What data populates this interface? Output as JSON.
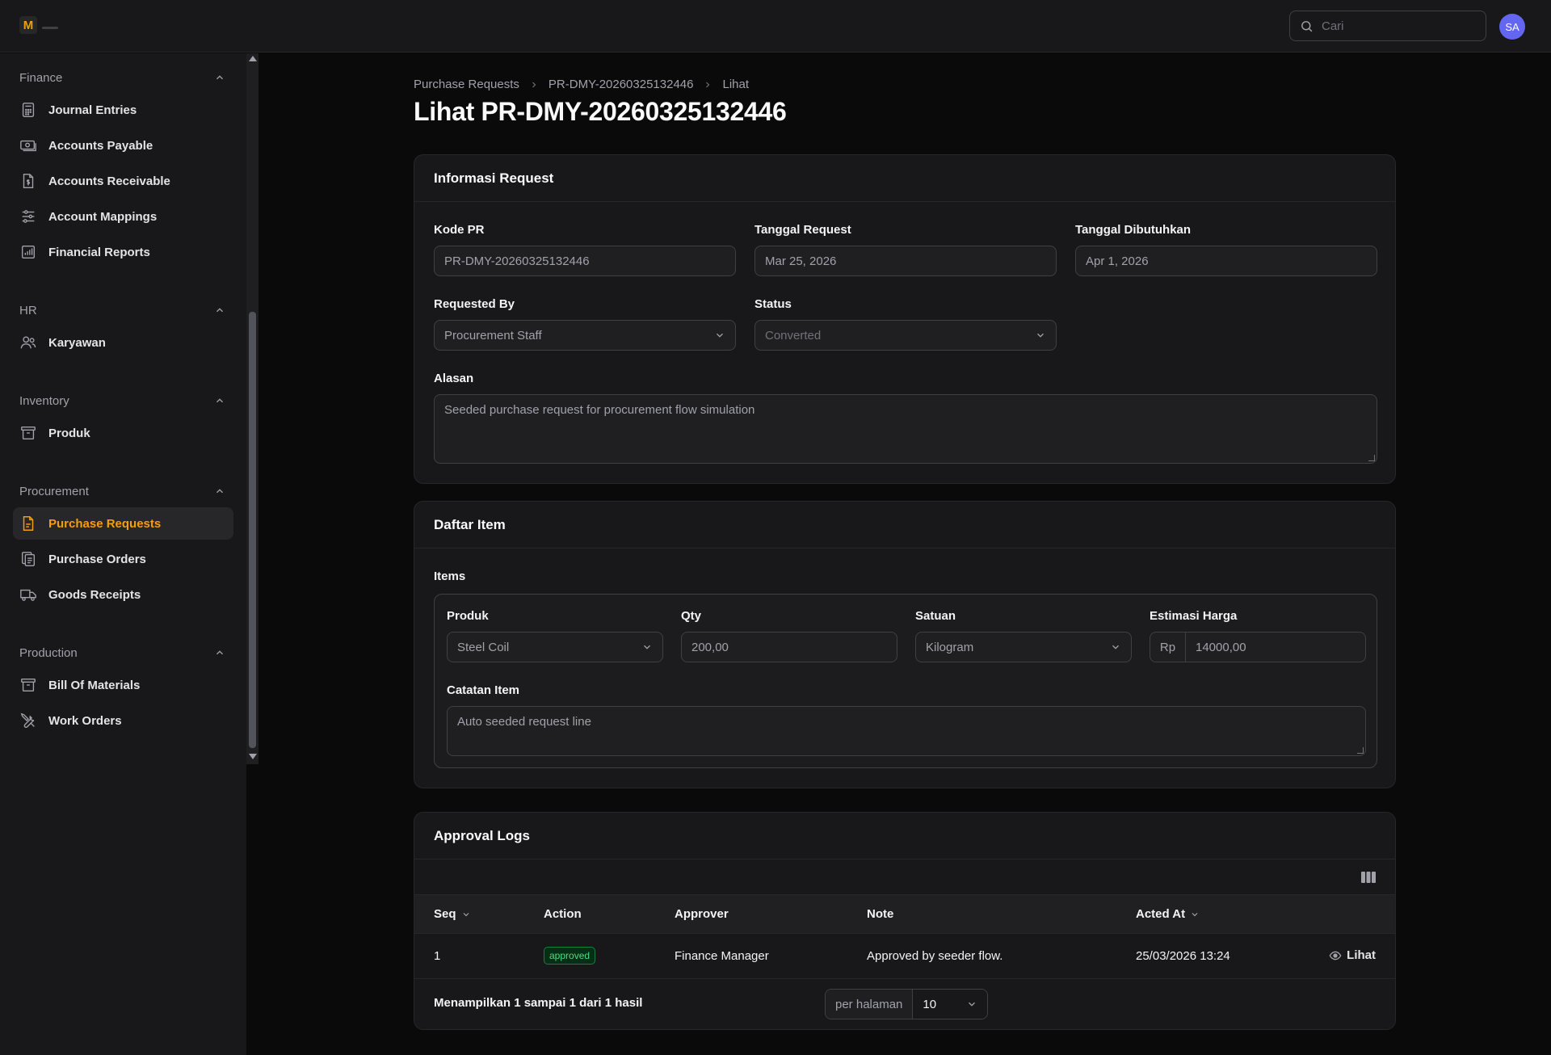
{
  "app": {
    "logo_letter": "M",
    "brand_color": "#f59e0b"
  },
  "topbar": {
    "search_placeholder": "Cari",
    "avatar_initials": "SA"
  },
  "sidebar": {
    "groups": [
      {
        "label": "Finance",
        "items": [
          {
            "label": "Journal Entries",
            "icon": "calculator-icon"
          },
          {
            "label": "Accounts Payable",
            "icon": "banknote-icon"
          },
          {
            "label": "Accounts Receivable",
            "icon": "document-dollar-icon"
          },
          {
            "label": "Account Mappings",
            "icon": "sliders-icon"
          },
          {
            "label": "Financial Reports",
            "icon": "chart-bar-icon"
          }
        ]
      },
      {
        "label": "HR",
        "items": [
          {
            "label": "Karyawan",
            "icon": "users-icon"
          }
        ]
      },
      {
        "label": "Inventory",
        "items": [
          {
            "label": "Produk",
            "icon": "archive-box-icon"
          }
        ]
      },
      {
        "label": "Procurement",
        "items": [
          {
            "label": "Purchase Requests",
            "icon": "document-text-icon",
            "active": true
          },
          {
            "label": "Purchase Orders",
            "icon": "clipboard-document-icon"
          },
          {
            "label": "Goods Receipts",
            "icon": "truck-icon"
          }
        ]
      },
      {
        "label": "Production",
        "items": [
          {
            "label": "Bill Of Materials",
            "icon": "archive-box-icon"
          },
          {
            "label": "Work Orders",
            "icon": "wrench-screwdriver-icon"
          }
        ]
      }
    ]
  },
  "breadcrumb": {
    "items": [
      "Purchase Requests",
      "PR-DMY-20260325132446",
      "Lihat"
    ]
  },
  "page": {
    "title": "Lihat PR-DMY-20260325132446"
  },
  "info_card": {
    "title": "Informasi Request",
    "kode_pr": {
      "label": "Kode PR",
      "value": "PR-DMY-20260325132446"
    },
    "tanggal_request": {
      "label": "Tanggal Request",
      "value": "Mar 25, 2026"
    },
    "tanggal_dibutuhkan": {
      "label": "Tanggal Dibutuhkan",
      "value": "Apr 1, 2026"
    },
    "requested_by": {
      "label": "Requested By",
      "value": "Procurement Staff"
    },
    "status": {
      "label": "Status",
      "value": "Converted"
    },
    "alasan": {
      "label": "Alasan",
      "value": "Seeded purchase request for procurement flow simulation"
    }
  },
  "items_card": {
    "title": "Daftar Item",
    "items_label": "Items",
    "produk": {
      "label": "Produk",
      "value": "Steel Coil"
    },
    "qty": {
      "label": "Qty",
      "value": "200,00"
    },
    "satuan": {
      "label": "Satuan",
      "value": "Kilogram"
    },
    "estimasi_harga": {
      "label": "Estimasi Harga",
      "prefix": "Rp",
      "value": "14000,00"
    },
    "catatan": {
      "label": "Catatan Item",
      "value": "Auto seeded request line"
    }
  },
  "approval_logs": {
    "title": "Approval Logs",
    "columns": {
      "seq": "Seq",
      "action": "Action",
      "approver": "Approver",
      "note": "Note",
      "acted_at": "Acted At"
    },
    "rows": [
      {
        "seq": "1",
        "action": "approved",
        "approver": "Finance Manager",
        "note": "Approved by seeder flow.",
        "acted_at": "25/03/2026 13:24",
        "view_label": "Lihat"
      }
    ],
    "footer": {
      "summary": "Menampilkan 1 sampai 1 dari 1 hasil",
      "per_page_label": "per halaman",
      "per_page_value": "10"
    }
  }
}
